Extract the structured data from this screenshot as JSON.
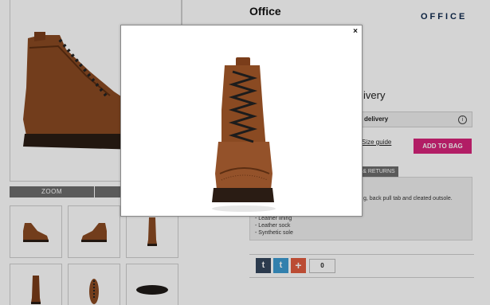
{
  "page": {
    "brand_title": "Office",
    "brand_logo": "OFFICE",
    "zoom_label": "ZOOM",
    "delivery_heading": "ivery",
    "delivery_box_label": "delivery",
    "info_icon": "i",
    "size_guide_label": "Size guide",
    "add_to_bag_label": "ADD TO BAG",
    "returns_tab_label": "& RETURNS",
    "details_text": "g, back pull tab and cleated outsole.",
    "specs": [
      "- Leather lining",
      "- Leather sock",
      "- Synthetic sole"
    ],
    "share_count": "0",
    "social": {
      "tumblr": "t",
      "twitter": "t",
      "plus": "+"
    }
  },
  "modal": {
    "close_label": "×"
  },
  "colors": {
    "add_to_bag": "#d6247a",
    "tumblr": "#34465d",
    "twitter": "#3d9ad1",
    "plus": "#e15c3f",
    "boot_leather": "#8a4a22",
    "boot_sole": "#2a1c14"
  }
}
